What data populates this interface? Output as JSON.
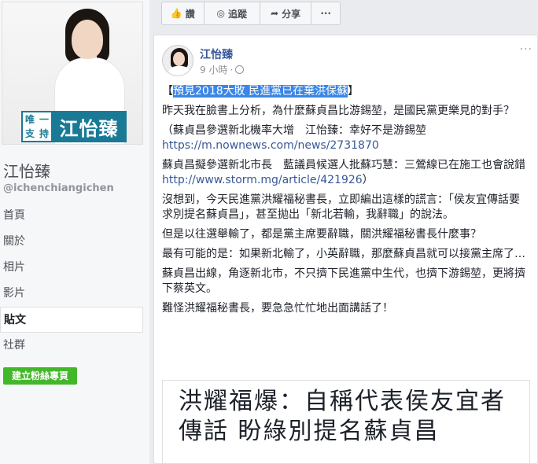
{
  "page": {
    "name": "江怡臻",
    "handle": "@ichenchiangichen",
    "badge_small": [
      "唯",
      "一",
      "支",
      "持"
    ],
    "badge_big": "江怡臻"
  },
  "nav": [
    {
      "label": "首頁",
      "active": false
    },
    {
      "label": "關於",
      "active": false
    },
    {
      "label": "相片",
      "active": false
    },
    {
      "label": "影片",
      "active": false
    },
    {
      "label": "貼文",
      "active": true
    },
    {
      "label": "社群",
      "active": false
    }
  ],
  "cta_label": "建立粉絲專頁",
  "action_bar": {
    "like": "讚",
    "follow": "追蹤",
    "share": "分享",
    "more": "···"
  },
  "post": {
    "author": "江怡臻",
    "time": "9 小時",
    "menu": "···",
    "headline_open": "【",
    "headline": "預見2018大敗 民進黨已在棄洪保蘇",
    "headline_close": "】",
    "p1": "昨天我在臉書上分析，為什麼蘇貞昌比游錫堃，是國民黨更樂見的對手？",
    "p2_text": "（蘇貞昌參選新北機率大增　江怡臻：幸好不是游錫堃",
    "p2_link": "https://m.nownews.com/news/2731870",
    "p3_text": "蘇貞昌擬參選新北市長　藍議員候選人批蘇巧慧：三鶯線已在施工也會說錯",
    "p3_link": "http://www.storm.mg/article/421926",
    "p3_close": "）",
    "p4": "沒想到，今天民進黨洪耀福秘書長，立即編出這樣的謊言：「侯友宜傳話要求別提名蘇貞昌」，甚至拋出「新北若輸，我辭職」的說法。",
    "p5": "但是以往選舉輸了，都是黨主席要辭職，關洪耀福秘書長什麼事？",
    "p6": "最有可能的是：如果新北輸了，小英辭職，那麼蘇貞昌就可以接黨主席了…",
    "p7": "蘇貞昌出線，角逐新北市，不只擠下民進黨中生代，也擠下游錫堃，更將擠下蔡英文。",
    "p8": "難怪洪耀福秘書長，要急急忙忙地出面講話了！"
  },
  "preview": {
    "title_line1": "洪耀福爆：自稱代表侯友宜者",
    "title_line2": "傳話 盼綠別提名蘇貞昌"
  }
}
